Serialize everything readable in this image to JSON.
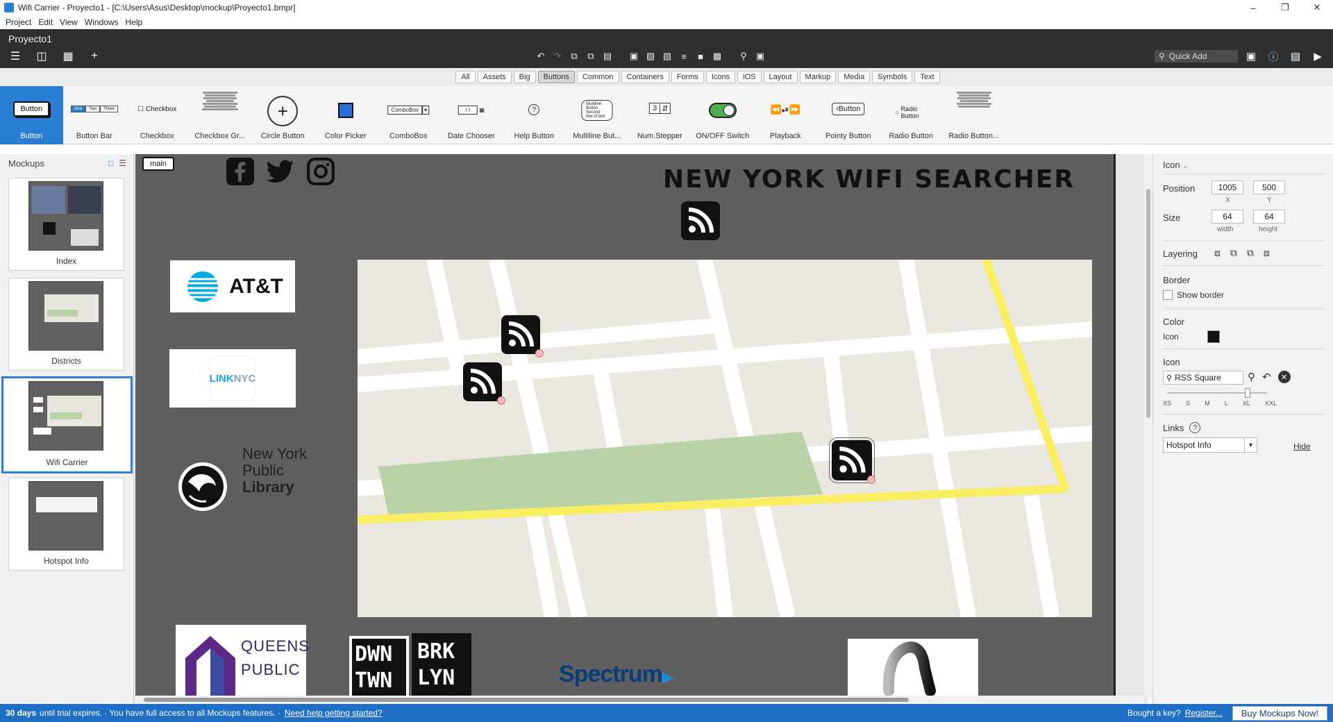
{
  "window": {
    "title": "Wifi Carrier - Proyecto1 - [C:\\Users\\Asus\\Desktop\\mockup\\Proyecto1.bmpr]"
  },
  "menu": {
    "items": [
      "Project",
      "Edit",
      "View",
      "Windows",
      "Help"
    ]
  },
  "project": {
    "name": "Proyecto1",
    "quick_add": "Quick Add"
  },
  "filters": {
    "tabs": [
      "All",
      "Assets",
      "Big",
      "Buttons",
      "Common",
      "Containers",
      "Forms",
      "Icons",
      "iOS",
      "Layout",
      "Markup",
      "Media",
      "Symbols",
      "Text"
    ],
    "active": "Buttons"
  },
  "library": {
    "items": [
      "Button",
      "Button Bar",
      "Checkbox",
      "Checkbox Gr...",
      "Circle Button",
      "Color Picker",
      "ComboBox",
      "Date Chooser",
      "Help Button",
      "Multiline But...",
      "Num.Stepper",
      "ON/OFF Switch",
      "Playback",
      "Pointy Button",
      "Radio Button",
      "Radio Button..."
    ],
    "previews": {
      "button": "Button",
      "checkbox": "Checkbox",
      "combobox": "ComboBox",
      "pointy": "Button",
      "radio": "Radio Button",
      "stepper": "3",
      "multiline1": "Multiline Button",
      "multiline2": "Second line of text",
      "date": "/ /",
      "bb1": "One",
      "bb2": "Two",
      "bb3": "Three"
    }
  },
  "mockups": {
    "title": "Mockups",
    "items": [
      "Index",
      "Districts",
      "Wifi Carrier",
      "Hotspot Info"
    ],
    "selected": "Wifi Carrier"
  },
  "canvas": {
    "tag": "main",
    "heading": "NEW YORK WIFI SEARCHER",
    "logos": {
      "att": "AT&T",
      "linknyc_a": "LINK",
      "linknyc_b": "NYC",
      "nypl_1": "New York",
      "nypl_2": "Public",
      "nypl_3": "Library",
      "queens_1": "QUEENS",
      "queens_2": "PUBLIC",
      "dwn1": "DWN",
      "dwn2": "TWN",
      "brk1": "BRK",
      "brk2": "LYN",
      "spectrum": "Spectrum"
    }
  },
  "inspector": {
    "type": "Icon",
    "position_label": "Position",
    "x": "1005",
    "y": "500",
    "x_label": "X",
    "y_label": "Y",
    "size_label": "Size",
    "width": "64",
    "height": "64",
    "width_label": "width",
    "height_label": "height",
    "layering_label": "Layering",
    "border_label": "Border",
    "show_border": "Show border",
    "color_label": "Color",
    "icon_color_label": "Icon",
    "icon_color": "#111111",
    "icon_label": "Icon",
    "icon_value": "RSS Square",
    "size_scale": [
      "XS",
      "S",
      "M",
      "L",
      "XL",
      "XXL"
    ],
    "links_label": "Links",
    "links_value": "Hotspot Info",
    "hide": "Hide"
  },
  "status": {
    "days": "30 days",
    "message": "until trial expires. · You have full access to all Mockups features. ·",
    "help_link": "Need help getting started?",
    "bought": "Bought a key?",
    "register": "Register...",
    "buy": "Buy Mockups Now!"
  }
}
